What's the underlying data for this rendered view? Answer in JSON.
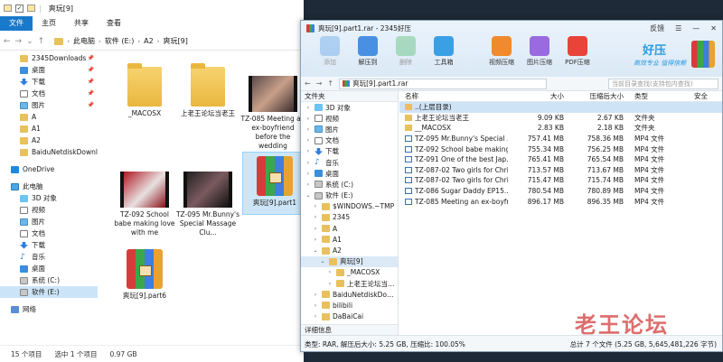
{
  "explorer": {
    "title": "爽玩[9]",
    "ribbon_tabs": [
      "文件",
      "主页",
      "共享",
      "查看"
    ],
    "breadcrumb": [
      "此电脑",
      "软件 (E:)",
      "A2",
      "爽玩[9]"
    ],
    "nav": [
      {
        "label": "2345Downloads",
        "icon": "folder",
        "pinned": true
      },
      {
        "label": "桌面",
        "icon": "desktop",
        "pinned": true
      },
      {
        "label": "下载",
        "icon": "download",
        "pinned": true
      },
      {
        "label": "文档",
        "icon": "document",
        "pinned": true
      },
      {
        "label": "图片",
        "icon": "picture",
        "pinned": true
      },
      {
        "label": "A",
        "icon": "folder"
      },
      {
        "label": "A1",
        "icon": "folder"
      },
      {
        "label": "A2",
        "icon": "folder"
      },
      {
        "label": "BaiduNetdiskDownlo",
        "icon": "folder"
      }
    ],
    "onedrive": "OneDrive",
    "this_pc": "此电脑",
    "pc_items": [
      {
        "label": "3D 对象",
        "icon": "3d"
      },
      {
        "label": "视频",
        "icon": "video"
      },
      {
        "label": "图片",
        "icon": "picture"
      },
      {
        "label": "文档",
        "icon": "document"
      },
      {
        "label": "下载",
        "icon": "download"
      },
      {
        "label": "音乐",
        "icon": "music"
      },
      {
        "label": "桌面",
        "icon": "desktop"
      },
      {
        "label": "系统 (C:)",
        "icon": "drive"
      },
      {
        "label": "软件 (E:)",
        "icon": "drive",
        "selected": true
      }
    ],
    "network": "网络",
    "files": [
      {
        "label": "_MACOSX",
        "kind": "folder"
      },
      {
        "label": "上老王论坛当老王",
        "kind": "folder"
      },
      {
        "label": "TZ-085 Meeting an ex-boyfriend before the wedding",
        "kind": "video"
      },
      {
        "label": "TZ-092 School babe making love with me",
        "kind": "video"
      },
      {
        "label": "TZ-095 Mr.Bunny's Special Massage Clu...",
        "kind": "video"
      },
      {
        "label": "爽玩[9].part1",
        "kind": "rar",
        "selected": true
      },
      {
        "label": "爽玩[9].part6",
        "kind": "rar"
      }
    ],
    "status": {
      "count": "15 个项目",
      "selected": "选中 1 个项目",
      "size": "0.97 GB"
    }
  },
  "rar": {
    "title": "爽玩[9].part1.rar - 2345好压",
    "title_ctrls": {
      "feedback": "反馈",
      "menu": "☰",
      "minimize": "—",
      "close": "✕"
    },
    "toolbar": [
      {
        "label": "添加",
        "disabled": true,
        "color": "#6aa9e6"
      },
      {
        "label": "解压到",
        "disabled": false,
        "color": "#4a90e2"
      },
      {
        "label": "删除",
        "disabled": true,
        "color": "#5fbf7a"
      },
      {
        "label": "工具箱",
        "disabled": false,
        "color": "#3aa0e6"
      },
      {
        "label": "视频压缩",
        "disabled": false,
        "color": "#f08a2c"
      },
      {
        "label": "图片压缩",
        "disabled": false,
        "color": "#9a6ae0"
      },
      {
        "label": "PDF压缩",
        "disabled": false,
        "color": "#e8443a"
      }
    ],
    "brand": {
      "name": "好压",
      "slogan": "高效专业 值得信赖"
    },
    "path": "爽玩[9].part1.rar",
    "search_placeholder": "当前目录查找(支持包内查找)",
    "tree_header": "文件夹",
    "tree_footer": "详细信息",
    "tree": [
      {
        "label": "3D 对象",
        "icon": "3d",
        "arrow": "›",
        "depth": 1
      },
      {
        "label": "视频",
        "icon": "video",
        "arrow": "›",
        "depth": 1
      },
      {
        "label": "图片",
        "icon": "picture",
        "arrow": "›",
        "depth": 1
      },
      {
        "label": "文档",
        "icon": "document",
        "arrow": "›",
        "depth": 1
      },
      {
        "label": "下载",
        "icon": "download",
        "arrow": "›",
        "depth": 1
      },
      {
        "label": "音乐",
        "icon": "music",
        "arrow": "›",
        "depth": 1
      },
      {
        "label": "桌面",
        "icon": "desktop",
        "arrow": "›",
        "depth": 1
      },
      {
        "label": "系统 (C:)",
        "icon": "drive",
        "arrow": "›",
        "depth": 1
      },
      {
        "label": "软件 (E:)",
        "icon": "drive",
        "arrow": "⌄",
        "depth": 1
      },
      {
        "label": "$WINDOWS.~TMP",
        "icon": "folder",
        "arrow": "›",
        "depth": 2
      },
      {
        "label": "2345",
        "icon": "folder",
        "arrow": "›",
        "depth": 2
      },
      {
        "label": "A",
        "icon": "folder",
        "arrow": "›",
        "depth": 2
      },
      {
        "label": "A1",
        "icon": "folder",
        "arrow": "›",
        "depth": 2
      },
      {
        "label": "A2",
        "icon": "folder",
        "arrow": "⌄",
        "depth": 2
      },
      {
        "label": "爽玩[9]",
        "icon": "folder",
        "arrow": "⌄",
        "depth": 3,
        "selected": true
      },
      {
        "label": "_MACOSX",
        "icon": "folder",
        "arrow": "›",
        "depth": 4
      },
      {
        "label": "上老王论坛当老王",
        "icon": "folder",
        "arrow": "›",
        "depth": 4
      },
      {
        "label": "BaiduNetdiskDownl",
        "icon": "folder",
        "arrow": "›",
        "depth": 2
      },
      {
        "label": "bilibili",
        "icon": "folder",
        "arrow": "›",
        "depth": 2
      },
      {
        "label": "DaBaiCai",
        "icon": "folder",
        "arrow": "›",
        "depth": 2
      }
    ],
    "columns": {
      "name": "名称",
      "size": "大小",
      "csize": "压缩后大小",
      "type": "类型",
      "security": "安全"
    },
    "rows": [
      {
        "name": "..(上层目录)",
        "size": "",
        "csize": "",
        "type": "",
        "kind": "folder",
        "selected": true
      },
      {
        "name": "上老王论坛当老王",
        "size": "9.09 KB",
        "csize": "2.67 KB",
        "type": "文件夹",
        "kind": "folder"
      },
      {
        "name": "__MACOSX",
        "size": "2.83 KB",
        "csize": "2.18 KB",
        "type": "文件夹",
        "kind": "folder"
      },
      {
        "name": "TZ-095 Mr.Bunny's Special ...",
        "size": "757.41 MB",
        "csize": "758.36 MB",
        "type": "MP4 文件",
        "kind": "video"
      },
      {
        "name": "TZ-092 School babe making...",
        "size": "755.34 MB",
        "csize": "756.25 MB",
        "type": "MP4 文件",
        "kind": "video"
      },
      {
        "name": "TZ-091 One of the best Jap...",
        "size": "765.41 MB",
        "csize": "765.54 MB",
        "type": "MP4 文件",
        "kind": "video"
      },
      {
        "name": "TZ-087-02 Two girls for Chri...",
        "size": "713.57 MB",
        "csize": "713.67 MB",
        "type": "MP4 文件",
        "kind": "video"
      },
      {
        "name": "TZ-087-02 Two girls for Chri...",
        "size": "715.47 MB",
        "csize": "715.74 MB",
        "type": "MP4 文件",
        "kind": "video"
      },
      {
        "name": "TZ-086 Sugar Daddy EP15...",
        "size": "780.54 MB",
        "csize": "780.89 MB",
        "type": "MP4 文件",
        "kind": "video"
      },
      {
        "name": "TZ-085 Meeting an ex-boyfr...",
        "size": "896.17 MB",
        "csize": "896.35 MB",
        "type": "MP4 文件",
        "kind": "video"
      }
    ],
    "status_left": "类型: RAR, 解压后大小: 5.25 GB, 压缩比: 100.05%",
    "status_right": "总计 7 个文件 (5.25 GB, 5,645,481,226 字节)"
  },
  "watermark": "老王论坛"
}
